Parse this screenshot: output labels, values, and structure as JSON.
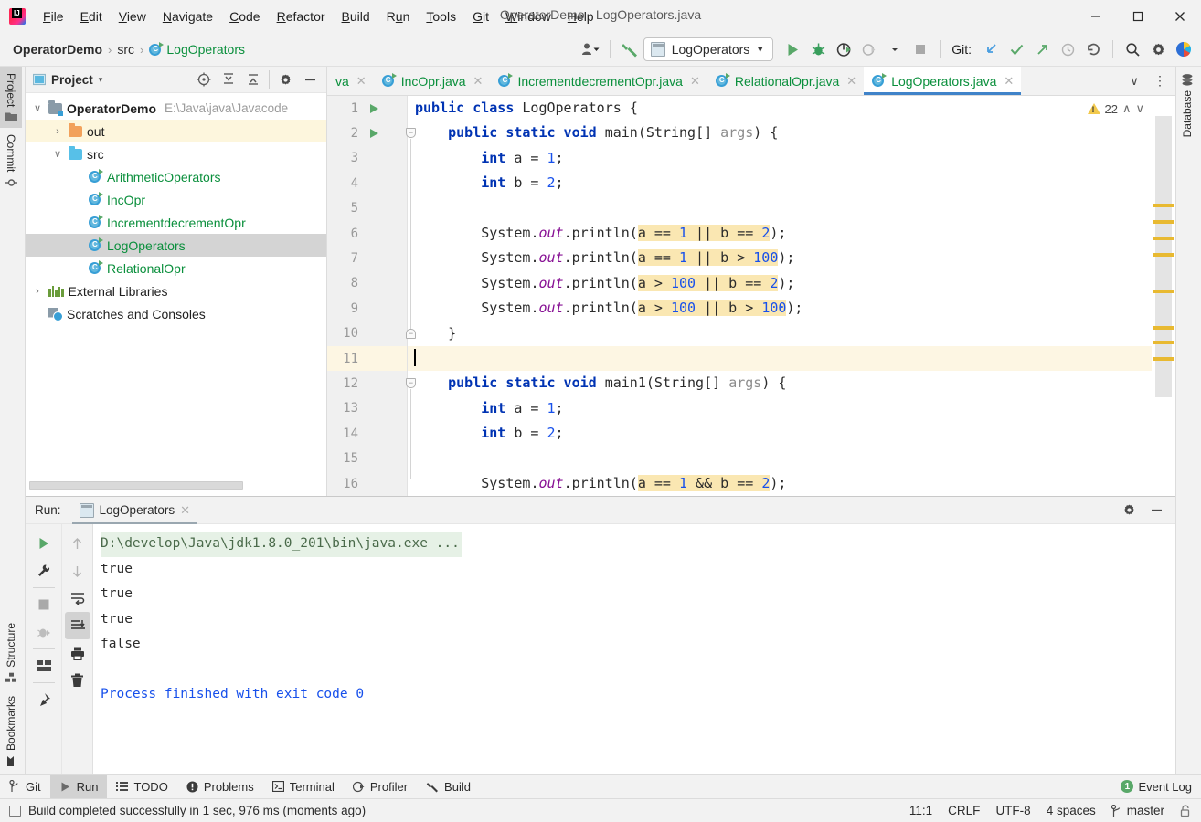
{
  "window": {
    "title": "OperatorDemo - LogOperators.java",
    "minimize": "—",
    "maximize": "☐",
    "close": "✕"
  },
  "menu": [
    {
      "label": "File",
      "mnemonic": "F"
    },
    {
      "label": "Edit",
      "mnemonic": "E"
    },
    {
      "label": "View",
      "mnemonic": "V"
    },
    {
      "label": "Navigate",
      "mnemonic": "N"
    },
    {
      "label": "Code",
      "mnemonic": "C"
    },
    {
      "label": "Refactor",
      "mnemonic": "R"
    },
    {
      "label": "Build",
      "mnemonic": "B"
    },
    {
      "label": "Run",
      "mnemonic": "u"
    },
    {
      "label": "Tools",
      "mnemonic": "T"
    },
    {
      "label": "Git",
      "mnemonic": "G"
    },
    {
      "label": "Window",
      "mnemonic": "W"
    },
    {
      "label": "Help",
      "mnemonic": "H"
    }
  ],
  "navbar": {
    "breadcrumbs": [
      "OperatorDemo",
      "src",
      "LogOperators"
    ],
    "separator": "›",
    "run_config": "LogOperators",
    "dropdown_arrow": "▼",
    "git_label": "Git:"
  },
  "left_stripe": {
    "top": [
      {
        "label": "Project",
        "icon": "project-icon",
        "active": true
      },
      {
        "label": "Commit",
        "icon": "commit-icon",
        "active": false
      }
    ],
    "bottom": [
      {
        "label": "Structure",
        "icon": "structure-icon"
      },
      {
        "label": "Bookmarks",
        "icon": "bookmarks-icon"
      }
    ]
  },
  "right_stripe": {
    "items": [
      {
        "label": "Database",
        "icon": "database-icon"
      }
    ]
  },
  "project_panel": {
    "title": "Project",
    "dropdown_arrow": "▾",
    "tree": [
      {
        "indent": 0,
        "arrow": "∨",
        "icon": "module-icon",
        "label": "OperatorDemo",
        "bold": true,
        "green": false,
        "path": "E:\\Java\\java\\Javacode",
        "state": "none"
      },
      {
        "indent": 1,
        "arrow": "›",
        "icon": "folder-orange",
        "label": "out",
        "bold": false,
        "green": false,
        "path": "",
        "state": "highlight"
      },
      {
        "indent": 1,
        "arrow": "∨",
        "icon": "folder-blue",
        "label": "src",
        "bold": false,
        "green": false,
        "path": "",
        "state": "none"
      },
      {
        "indent": 2,
        "arrow": "",
        "icon": "class-icon",
        "label": "ArithmeticOperators",
        "bold": false,
        "green": true,
        "path": "",
        "state": "none"
      },
      {
        "indent": 2,
        "arrow": "",
        "icon": "class-icon",
        "label": "IncOpr",
        "bold": false,
        "green": true,
        "path": "",
        "state": "none"
      },
      {
        "indent": 2,
        "arrow": "",
        "icon": "class-icon",
        "label": "IncrementdecrementOpr",
        "bold": false,
        "green": true,
        "path": "",
        "state": "none"
      },
      {
        "indent": 2,
        "arrow": "",
        "icon": "class-icon",
        "label": "LogOperators",
        "bold": false,
        "green": true,
        "path": "",
        "state": "selected"
      },
      {
        "indent": 2,
        "arrow": "",
        "icon": "class-icon",
        "label": "RelationalOpr",
        "bold": false,
        "green": true,
        "path": "",
        "state": "none"
      },
      {
        "indent": 0,
        "arrow": "›",
        "icon": "library-icon",
        "label": "External Libraries",
        "bold": false,
        "green": false,
        "path": "",
        "state": "none"
      },
      {
        "indent": 0,
        "arrow": "",
        "icon": "scratch-icon",
        "label": "Scratches and Consoles",
        "bold": false,
        "green": false,
        "path": "",
        "state": "none"
      }
    ]
  },
  "editor": {
    "tabs": [
      {
        "label": "va",
        "active": false,
        "truncated": true
      },
      {
        "label": "IncOpr.java",
        "active": false,
        "truncated": false
      },
      {
        "label": "IncrementdecrementOpr.java",
        "active": false,
        "truncated": false
      },
      {
        "label": "RelationalOpr.java",
        "active": false,
        "truncated": false
      },
      {
        "label": "LogOperators.java",
        "active": true,
        "truncated": false
      }
    ],
    "close_glyph": "✕",
    "tabs_more": "∨",
    "tabs_menu": "⋮",
    "warning_count": "22",
    "warn_up": "∧",
    "warn_down": "∨",
    "lines": [
      {
        "num": "1",
        "runmark": true,
        "fold": "",
        "highlight": false,
        "tokens": [
          {
            "t": "public ",
            "c": "k"
          },
          {
            "t": "class ",
            "c": "k"
          },
          {
            "t": "LogOperators ",
            "c": "t"
          },
          {
            "t": "{",
            "c": "t"
          }
        ]
      },
      {
        "num": "2",
        "runmark": true,
        "fold": "start",
        "highlight": false,
        "tokens": [
          {
            "t": "    ",
            "c": "t"
          },
          {
            "t": "public static void ",
            "c": "k"
          },
          {
            "t": "main",
            "c": "t"
          },
          {
            "t": "(",
            "c": "t"
          },
          {
            "t": "String",
            "c": "t"
          },
          {
            "t": "[] ",
            "c": "t"
          },
          {
            "t": "args",
            "c": "p"
          },
          {
            "t": ") {",
            "c": "t"
          }
        ]
      },
      {
        "num": "3",
        "runmark": false,
        "fold": "",
        "highlight": false,
        "tokens": [
          {
            "t": "        ",
            "c": "t"
          },
          {
            "t": "int ",
            "c": "k"
          },
          {
            "t": "a = ",
            "c": "t"
          },
          {
            "t": "1",
            "c": "n"
          },
          {
            "t": ";",
            "c": "t"
          }
        ]
      },
      {
        "num": "4",
        "runmark": false,
        "fold": "",
        "highlight": false,
        "tokens": [
          {
            "t": "        ",
            "c": "t"
          },
          {
            "t": "int ",
            "c": "k"
          },
          {
            "t": "b = ",
            "c": "t"
          },
          {
            "t": "2",
            "c": "n"
          },
          {
            "t": ";",
            "c": "t"
          }
        ]
      },
      {
        "num": "5",
        "runmark": false,
        "fold": "",
        "highlight": false,
        "tokens": []
      },
      {
        "num": "6",
        "runmark": false,
        "fold": "",
        "highlight": false,
        "tokens": [
          {
            "t": "        ",
            "c": "t"
          },
          {
            "t": "System",
            "c": "t"
          },
          {
            "t": ".",
            "c": "t"
          },
          {
            "t": "out",
            "c": "f"
          },
          {
            "t": ".println(",
            "c": "t"
          },
          {
            "t": "a == ",
            "c": "t",
            "hl": true
          },
          {
            "t": "1",
            "c": "n",
            "hl": true
          },
          {
            "t": " || b == ",
            "c": "t",
            "hl": true
          },
          {
            "t": "2",
            "c": "n",
            "hl": true
          },
          {
            "t": ");",
            "c": "t"
          }
        ]
      },
      {
        "num": "7",
        "runmark": false,
        "fold": "",
        "highlight": false,
        "tokens": [
          {
            "t": "        ",
            "c": "t"
          },
          {
            "t": "System",
            "c": "t"
          },
          {
            "t": ".",
            "c": "t"
          },
          {
            "t": "out",
            "c": "f"
          },
          {
            "t": ".println(",
            "c": "t"
          },
          {
            "t": "a == ",
            "c": "t",
            "hl": true
          },
          {
            "t": "1",
            "c": "n",
            "hl": true
          },
          {
            "t": " || b > ",
            "c": "t",
            "hl": true
          },
          {
            "t": "100",
            "c": "n",
            "hl": true
          },
          {
            "t": ");",
            "c": "t"
          }
        ]
      },
      {
        "num": "8",
        "runmark": false,
        "fold": "",
        "highlight": false,
        "tokens": [
          {
            "t": "        ",
            "c": "t"
          },
          {
            "t": "System",
            "c": "t"
          },
          {
            "t": ".",
            "c": "t"
          },
          {
            "t": "out",
            "c": "f"
          },
          {
            "t": ".println(",
            "c": "t"
          },
          {
            "t": "a > ",
            "c": "t",
            "hl": true
          },
          {
            "t": "100",
            "c": "n",
            "hl": true
          },
          {
            "t": " || b == ",
            "c": "t",
            "hl": true
          },
          {
            "t": "2",
            "c": "n",
            "hl": true
          },
          {
            "t": ");",
            "c": "t"
          }
        ]
      },
      {
        "num": "9",
        "runmark": false,
        "fold": "",
        "highlight": false,
        "tokens": [
          {
            "t": "        ",
            "c": "t"
          },
          {
            "t": "System",
            "c": "t"
          },
          {
            "t": ".",
            "c": "t"
          },
          {
            "t": "out",
            "c": "f"
          },
          {
            "t": ".println(",
            "c": "t"
          },
          {
            "t": "a > ",
            "c": "t",
            "hl": true
          },
          {
            "t": "100",
            "c": "n",
            "hl": true
          },
          {
            "t": " || b > ",
            "c": "t",
            "hl": true
          },
          {
            "t": "100",
            "c": "n",
            "hl": true
          },
          {
            "t": ");",
            "c": "t"
          }
        ]
      },
      {
        "num": "10",
        "runmark": false,
        "fold": "end",
        "highlight": false,
        "tokens": [
          {
            "t": "    }",
            "c": "t"
          }
        ]
      },
      {
        "num": "11",
        "runmark": false,
        "fold": "",
        "highlight": true,
        "caret": true,
        "tokens": []
      },
      {
        "num": "12",
        "runmark": false,
        "fold": "start",
        "highlight": false,
        "tokens": [
          {
            "t": "    ",
            "c": "t"
          },
          {
            "t": "public static void ",
            "c": "k"
          },
          {
            "t": "main1",
            "c": "t"
          },
          {
            "t": "(",
            "c": "t"
          },
          {
            "t": "String",
            "c": "t"
          },
          {
            "t": "[] ",
            "c": "t"
          },
          {
            "t": "args",
            "c": "p"
          },
          {
            "t": ") {",
            "c": "t"
          }
        ]
      },
      {
        "num": "13",
        "runmark": false,
        "fold": "",
        "highlight": false,
        "tokens": [
          {
            "t": "        ",
            "c": "t"
          },
          {
            "t": "int ",
            "c": "k"
          },
          {
            "t": "a = ",
            "c": "t"
          },
          {
            "t": "1",
            "c": "n"
          },
          {
            "t": ";",
            "c": "t"
          }
        ]
      },
      {
        "num": "14",
        "runmark": false,
        "fold": "",
        "highlight": false,
        "tokens": [
          {
            "t": "        ",
            "c": "t"
          },
          {
            "t": "int ",
            "c": "k"
          },
          {
            "t": "b = ",
            "c": "t"
          },
          {
            "t": "2",
            "c": "n"
          },
          {
            "t": ";",
            "c": "t"
          }
        ]
      },
      {
        "num": "15",
        "runmark": false,
        "fold": "",
        "highlight": false,
        "tokens": []
      },
      {
        "num": "16",
        "runmark": false,
        "fold": "",
        "highlight": false,
        "tokens": [
          {
            "t": "        ",
            "c": "t"
          },
          {
            "t": "System",
            "c": "t"
          },
          {
            "t": ".",
            "c": "t"
          },
          {
            "t": "out",
            "c": "f"
          },
          {
            "t": ".println(",
            "c": "t"
          },
          {
            "t": "a == ",
            "c": "t",
            "hl": true
          },
          {
            "t": "1",
            "c": "n",
            "hl": true
          },
          {
            "t": " && b == ",
            "c": "t",
            "hl": true
          },
          {
            "t": "2",
            "c": "n",
            "hl": true
          },
          {
            "t": ");",
            "c": "t"
          }
        ]
      }
    ],
    "scroll_marks": [
      118,
      136,
      154,
      172,
      212,
      252,
      268,
      286
    ]
  },
  "run_window": {
    "title": "Run:",
    "tab_label": "LogOperators",
    "close_glyph": "✕",
    "console": [
      {
        "text": "D:\\develop\\Java\\jdk1.8.0_201\\bin\\java.exe ...",
        "style": "cmd"
      },
      {
        "text": "true",
        "style": "out"
      },
      {
        "text": "true",
        "style": "out"
      },
      {
        "text": "true",
        "style": "out"
      },
      {
        "text": "false",
        "style": "out"
      },
      {
        "text": "",
        "style": "out"
      },
      {
        "text": "Process finished with exit code 0",
        "style": "finish"
      }
    ]
  },
  "bottom_bar": {
    "items": [
      {
        "label": "Git",
        "icon": "git-branch-icon",
        "active": false
      },
      {
        "label": "Run",
        "icon": "run-play-icon",
        "active": true
      },
      {
        "label": "TODO",
        "icon": "todo-list-icon",
        "active": false
      },
      {
        "label": "Problems",
        "icon": "problems-icon",
        "active": false
      },
      {
        "label": "Terminal",
        "icon": "terminal-icon",
        "active": false
      },
      {
        "label": "Profiler",
        "icon": "profiler-icon",
        "active": false
      },
      {
        "label": "Build",
        "icon": "build-hammer-icon",
        "active": false
      }
    ],
    "event_log": {
      "label": "Event Log",
      "badge": "1"
    }
  },
  "status_bar": {
    "message": "Build completed successfully in 1 sec, 976 ms (moments ago)",
    "position": "11:1",
    "line_separator": "CRLF",
    "encoding": "UTF-8",
    "indent": "4 spaces",
    "branch": "master"
  },
  "colors": {
    "accent_blue": "#4083c9",
    "green": "#0a8f3c",
    "warning_yellow": "#f2c94c",
    "highlight_yellow": "#fae7b2",
    "selection_gray": "#d4d4d4"
  }
}
